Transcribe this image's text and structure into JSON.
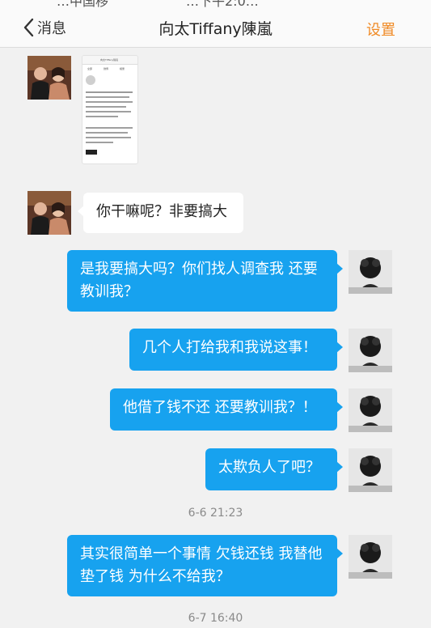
{
  "status_bar": {
    "left_text": "…中国移",
    "center_text": "…下午2:0…"
  },
  "nav": {
    "back_label": "消息",
    "title": "向太Tiffany陳嵐",
    "settings_label": "设置"
  },
  "shared_screenshot": {
    "labels": [
      "向太Tiffany陳嵐",
      "全部",
      "微博",
      "相册"
    ]
  },
  "messages": [
    {
      "text": "你干嘛呢？非要搞大"
    },
    {
      "text": "是我要搞大吗？你们找人调查我 还要教训我？"
    },
    {
      "text": "几个人打给我和我说这事！"
    },
    {
      "text": "他借了钱不还 还要教训我？！"
    },
    {
      "text": "太欺负人了吧？"
    },
    {
      "text": "其实很简单一个事情 欠钱还钱 我替他垫了钱 为什么不给我？"
    }
  ],
  "timestamps": [
    "6-6 21:23",
    "6-7 16:40"
  ],
  "colors": {
    "accent": "#17a2ef",
    "settings": "#f08a24",
    "background": "#f1f1f1"
  }
}
